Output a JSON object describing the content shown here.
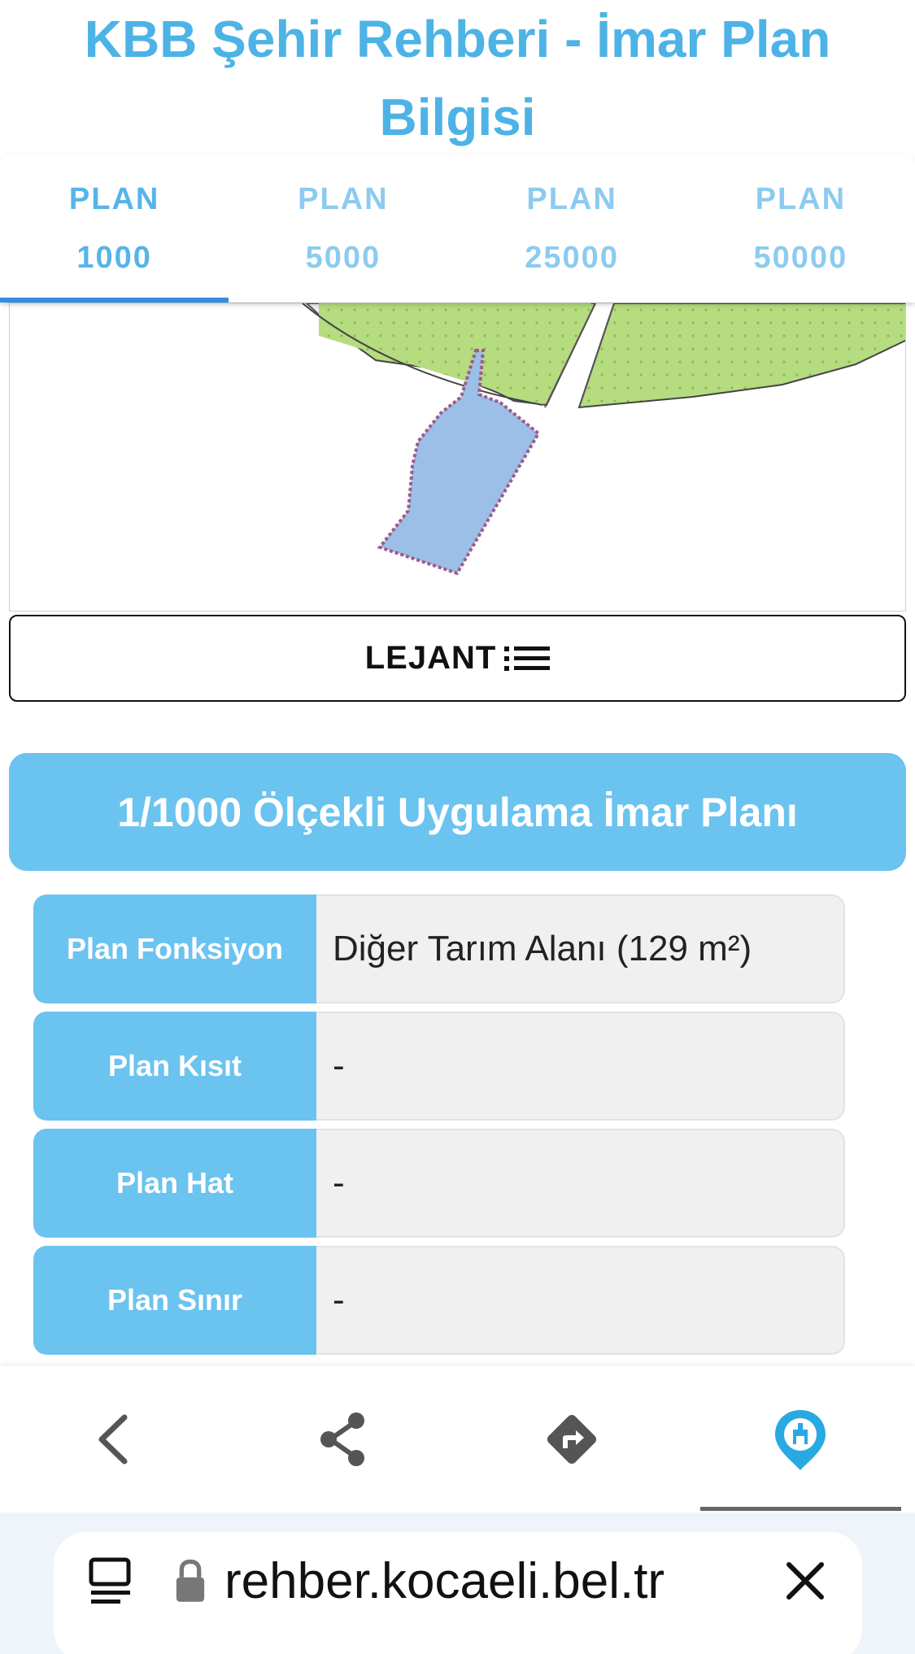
{
  "page": {
    "title": "KBB Şehir Rehberi - İmar Plan Bilgisi"
  },
  "tabs": [
    {
      "line1": "PLAN",
      "line2": "1000",
      "active": true
    },
    {
      "line1": "PLAN",
      "line2": "5000",
      "active": false
    },
    {
      "line1": "PLAN",
      "line2": "25000",
      "active": false
    },
    {
      "line1": "PLAN",
      "line2": "50000",
      "active": false
    }
  ],
  "legend": {
    "label": "LEJANT",
    "icon": "list-icon"
  },
  "section": {
    "title": "1/1000 Ölçekli Uygulama İmar Planı"
  },
  "plan_info": [
    {
      "label": "Plan Fonksiyon",
      "value": "Diğer Tarım Alanı (129 m²)"
    },
    {
      "label": "Plan Kısıt",
      "value": "-"
    },
    {
      "label": "Plan Hat",
      "value": "-"
    },
    {
      "label": "Plan Sınır",
      "value": "-"
    }
  ],
  "toolbar": {
    "items": [
      "back-icon",
      "share-icon",
      "directions-icon",
      "city-logo-icon"
    ],
    "active_index": 3
  },
  "browser": {
    "url": "rehber.kocaeli.bel.tr",
    "left_icon": "tabs-menu-icon",
    "lock_icon": "lock-icon",
    "close_icon": "close-icon"
  },
  "colors": {
    "accent": "#56b4e9",
    "header_bg": "#6bc3ef",
    "parcel_fill": "#9bbfe6",
    "green_area": "#b5dc7e"
  }
}
